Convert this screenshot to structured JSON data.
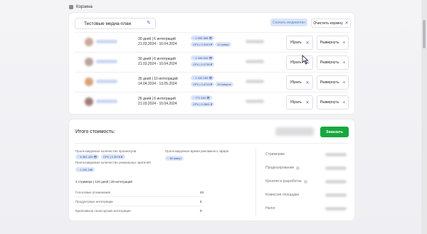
{
  "breadcrumb": {
    "label": "Корзина"
  },
  "plan": {
    "name": "Тестовые медиа-план",
    "btn_mediaplan": "Скачать медиаплан",
    "btn_clear": "Очистить корзину"
  },
  "rows": [
    {
      "avatar_color": "#c9a898",
      "info1": "30 дней | 6 интеграций",
      "info2": "21.03.2024 - 10.04.2024",
      "p1": "~ 2 095 568 👁",
      "p2": "CPV | 0.3143 ₽",
      "p3": "12 минут",
      "remove": "Убрать",
      "expand": "Развернуть"
    },
    {
      "avatar_color": "#b8a39d",
      "info1": "30 дней | 6 интеграций",
      "info2": "21.03.2024 - 10.04.2024",
      "p1": "~ 2 445 634 👁",
      "p2": "CPV | 0.2735 ₽",
      "p3": "",
      "remove": "Убрать",
      "expand": "Развернуть"
    },
    {
      "avatar_color": "#d8a276",
      "info1": "35 дней | 10 интеграций",
      "info2": "14.04.2024 - 13.05.2024",
      "p1": "~ 1 049 183 👁",
      "p2": "CPV | 0.4715 ₽",
      "p3": "44 минуты",
      "remove": "Убрать",
      "expand": "Развернуть"
    },
    {
      "avatar_color": "#a07e78",
      "info1": "26 дней | 6 интеграций",
      "info2": "21.03.2024 - 10.04.2024",
      "p1": "~ 771 440 👁",
      "p2": "CPV | 0.2961 ₽",
      "p3": "",
      "remove": "Убрать",
      "expand": "Развернуть"
    }
  ],
  "total": {
    "title": "Итого стоимость:",
    "order_button": "Заказать",
    "forecast_views_label": "Прогнозируемое количество просмотров",
    "forecast_time_label": "Прогнозируемое время рекламного эфира",
    "views_pill": "~ 6 362 429 👁",
    "cpv_pill": "CPV | 0.3978 ₽",
    "time_pill": "~ 60 минут",
    "unique_label": "Прогнозируемое количество уникальных зрителей",
    "unique_pill": "~ 1 244 188",
    "summary": "4 стримера | 120 дней | 28 интеграций",
    "stats": [
      {
        "label": "Голосовые упоминания",
        "value": "24"
      },
      {
        "label": "Продуктовые интеграции",
        "value": "4"
      },
      {
        "label": "Креативные спонсорские интеграции",
        "value": "0"
      }
    ],
    "right_labels": [
      "Стримерам",
      "Продюсирование",
      "Креатив и разработка",
      "Комиссия площадки",
      "Налог"
    ]
  }
}
